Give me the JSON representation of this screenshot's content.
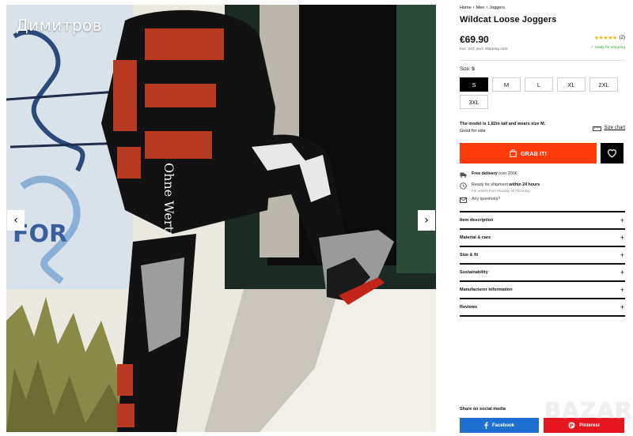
{
  "photo": {
    "overlay_name": "Димитров",
    "prev_arrow": "‹",
    "next_arrow": "›"
  },
  "breadcrumb": [
    "Home",
    "Men",
    "Joggers"
  ],
  "product": {
    "title": "Wildcat Loose Joggers",
    "price": "€69.90",
    "vat_note": "Incl. VAT, excl. shipping cost",
    "rating_stars": "★★★★★",
    "rating_count": "(2)",
    "ready_for_shipping": "✓ ready for shipping"
  },
  "size": {
    "label": "Size:",
    "selected": "S",
    "options": [
      "S",
      "M",
      "L",
      "XL",
      "2XL",
      "3XL"
    ]
  },
  "model": {
    "line1_prefix": "The model is 1,82m tall and wears size M.",
    "line2": "Good for size",
    "size_chart": "Size chart"
  },
  "buy": {
    "grab_label": "GRAB IT!"
  },
  "info": {
    "delivery_bold": "Free delivery",
    "delivery_light": " over 200€",
    "shipment_light": "Ready for shipment ",
    "shipment_bold": "within 24 hours",
    "shipment_sub": "For orders from Monday till Thursday",
    "questions": "Any questions?"
  },
  "accordion": [
    "Item description",
    "Material & care",
    "Size & fit",
    "Sustainability",
    "Manufacturer information",
    "Reviews"
  ],
  "accordion_plus": "+",
  "share": {
    "label": "Share on social media",
    "facebook": "Facebook",
    "pinterest": "Pinterest"
  },
  "watermark": "BAZAR",
  "colors": {
    "accent": "#ff3c0a",
    "facebook": "#1f6fd1",
    "pinterest": "#e6151f",
    "star": "#f5b400",
    "ready_green": "#2ea43a"
  }
}
